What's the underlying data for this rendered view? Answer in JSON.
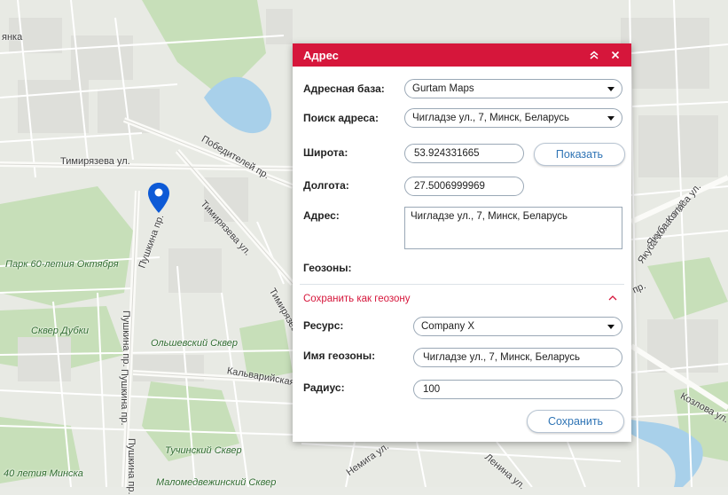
{
  "map": {
    "labels": {
      "district": "янка",
      "timiryazeva_ul": "Тимирязева ул.",
      "pobediteley_pr": "Победителей пр.",
      "timiryazeva_ul_2": "Тимирязева ул.",
      "pushkina_pr_1": "Пушкина пр.",
      "park": "Парк 60-летия Октября",
      "skver_dubki": "Сквер Дубки",
      "pushkina_pr_2": "Пушкина пр.",
      "olshevsky": "Ольшевский Сквер",
      "kalvariyskaya": "Кальварийская",
      "pushkina_pr_3": "Пушкина пр.",
      "pushkina_pr_4": "Пушкина пр.",
      "tuchinsky": "Тучинский Сквер",
      "minsk_park": "40 летия Минска",
      "malomed": "Маломедвежинский Сквер",
      "yakuba_kolasa_1": "Якуба Коласа ул.",
      "yakuba_kolasa_2": "Якуба Коласа ул.",
      "kozlova": "Козлова ул.",
      "nemiga": "Немига ул.",
      "lenina": "Ленина ул.",
      "timiryazeva_3": "Тимирязева",
      "pr_right": "пр."
    },
    "marker_color": "#0d5ad6"
  },
  "dialog": {
    "title": "Адрес",
    "header_color": "#d6163b",
    "address_base_label": "Адресная база:",
    "address_base_value": "Gurtam Maps",
    "search_label": "Поиск адреса:",
    "search_value": "Чигладзе ул., 7, Минск, Беларусь",
    "latitude_label": "Широта:",
    "latitude_value": "53.924331665",
    "show_button": "Показать",
    "longitude_label": "Долгота:",
    "longitude_value": "27.5006999969",
    "address_label": "Адрес:",
    "address_value": "Чигладзе ул., 7, Минск, Беларусь",
    "geozones_label": "Геозоны:",
    "save_as_geozone": "Сохранить как геозону",
    "resource_label": "Ресурс:",
    "resource_value": "Company X",
    "geozone_name_label": "Имя геозоны:",
    "geozone_name_value": "Чигладзе ул., 7, Минск, Беларусь",
    "radius_label": "Радиус:",
    "radius_value": "100",
    "save_button": "Сохранить"
  }
}
